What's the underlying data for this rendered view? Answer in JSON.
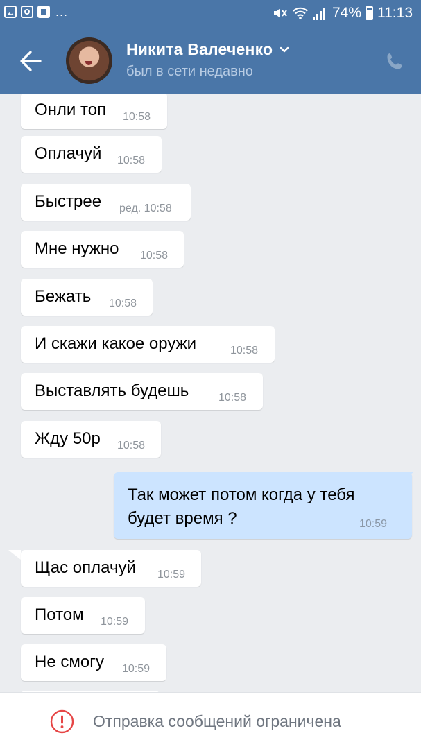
{
  "status_bar": {
    "dots": "...",
    "battery": "74%",
    "time": "11:13"
  },
  "header": {
    "name": "Никита Валеченко",
    "status": "был в сети недавно"
  },
  "messages": [
    {
      "text": "Онли топ",
      "time": "10:58"
    },
    {
      "text": "Оплачуй",
      "time": "10:58"
    },
    {
      "text": "Быстрее",
      "time": "ред. 10:58"
    },
    {
      "text": "Мне нужно",
      "time": "10:58"
    },
    {
      "text": "Бежать",
      "time": "10:58"
    },
    {
      "text": "И скажи какое оружи",
      "time": "10:58"
    },
    {
      "text": "Выставлять будешь",
      "time": "10:58"
    },
    {
      "text": "Жду 50р",
      "time": "10:58"
    },
    {
      "text": "Так может потом когда у тебя будет время ?",
      "time": "10:59",
      "outgoing": true
    },
    {
      "text": "Щас оплачуй",
      "time": "10:59"
    },
    {
      "text": "Потом",
      "time": "10:59"
    },
    {
      "text": "Не смогу",
      "time": "10:59"
    }
  ],
  "footer": {
    "text": "Отправка сообщений ограничена"
  },
  "colors": {
    "accent": "#4a76a8",
    "incoming_bubble": "#ffffff",
    "outgoing_bubble": "#cce4ff",
    "background": "#ebedf0",
    "alert": "#e64646"
  }
}
